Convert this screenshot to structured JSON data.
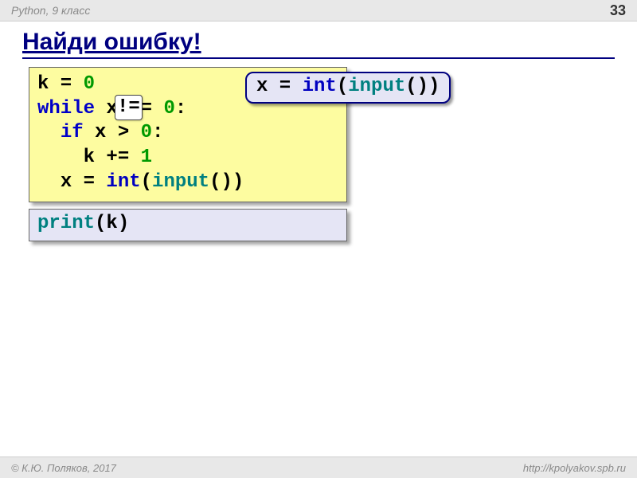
{
  "header": {
    "course": "Python, 9 класс",
    "page_number": "33"
  },
  "title": "Найди ошибку!",
  "code_main": {
    "line1": {
      "k": "k",
      "eq": " = ",
      "zero": "0"
    },
    "line2": {
      "while": "while",
      "sp1": " x ",
      "ne": "!=",
      "sp2": " ",
      "zero": "0",
      "colon": ":"
    },
    "line3": {
      "indent": "  ",
      "if": "if",
      "sp": " x > ",
      "zero": "0",
      "colon": ":"
    },
    "line4": {
      "indent": "    ",
      "k": "k += ",
      "one": "1"
    },
    "line5": {
      "indent": "  ",
      "x": "x = ",
      "int": "int",
      "lp": "(",
      "input": "input",
      "rp": "())"
    }
  },
  "ne_overlay": "!=",
  "callout": {
    "x": "x = ",
    "int": "int",
    "lp": "(",
    "input": "input",
    "rp": "())"
  },
  "code_print": {
    "print": "print",
    "lp": "(",
    "k": "k",
    "rp": ")"
  },
  "footer": {
    "copyright": "© К.Ю. Поляков, 2017",
    "url": "http://kpolyakov.spb.ru"
  }
}
